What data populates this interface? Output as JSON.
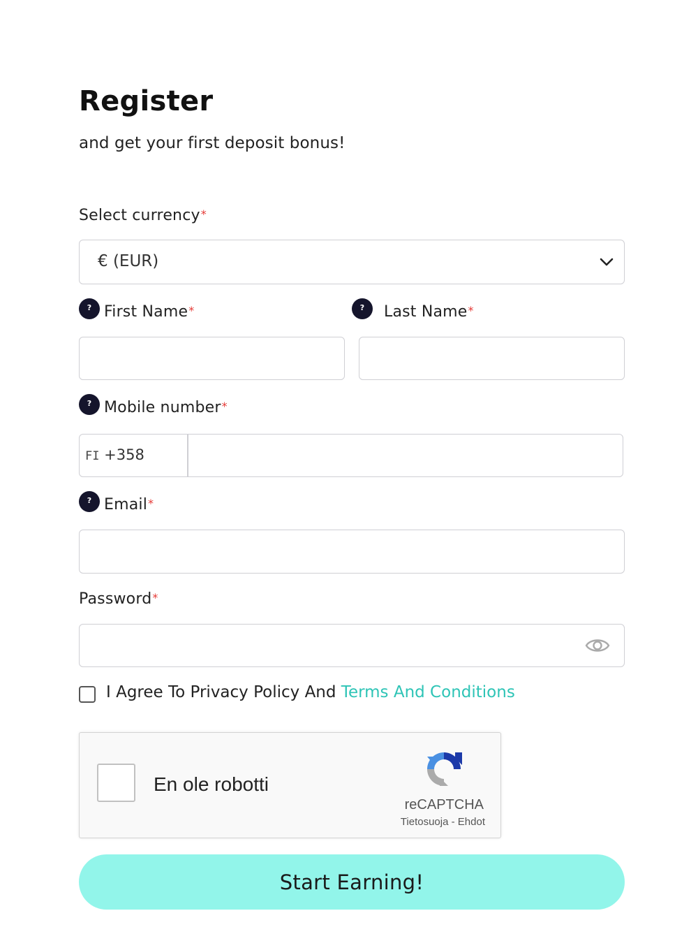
{
  "header": {
    "title": "Register",
    "subtitle": "and get your first deposit bonus!"
  },
  "currency": {
    "label": "Select currency",
    "required_mark": "*",
    "selected_value": "€ (EUR)"
  },
  "first_name": {
    "label": "First Name",
    "required_mark": "*",
    "help_icon": "?",
    "value": ""
  },
  "last_name": {
    "label": "Last Name",
    "required_mark": "*",
    "help_icon": "?",
    "value": ""
  },
  "mobile": {
    "label": "Mobile number",
    "required_mark": "*",
    "help_icon": "?",
    "country_code": "FI",
    "dial_code": "+358",
    "value": ""
  },
  "email": {
    "label": "Email",
    "required_mark": "*",
    "help_icon": "?",
    "value": ""
  },
  "password": {
    "label": "Password",
    "required_mark": "*",
    "value": "",
    "toggle_icon": "eye-icon"
  },
  "agreement": {
    "text": "I Agree To Privacy Policy And",
    "link_text": "Terms And Conditions",
    "checked": false
  },
  "captcha": {
    "label": "En ole robotti",
    "brand": "reCAPTCHA",
    "privacy_link": "Tietosuoja",
    "separator": "-",
    "terms_link": "Ehdot"
  },
  "submit": {
    "label": "Start Earning!"
  },
  "colors": {
    "accent_button": "#92f5ea",
    "link": "#2ec4b6",
    "required": "#e53935",
    "help_icon_bg": "#15152c"
  }
}
